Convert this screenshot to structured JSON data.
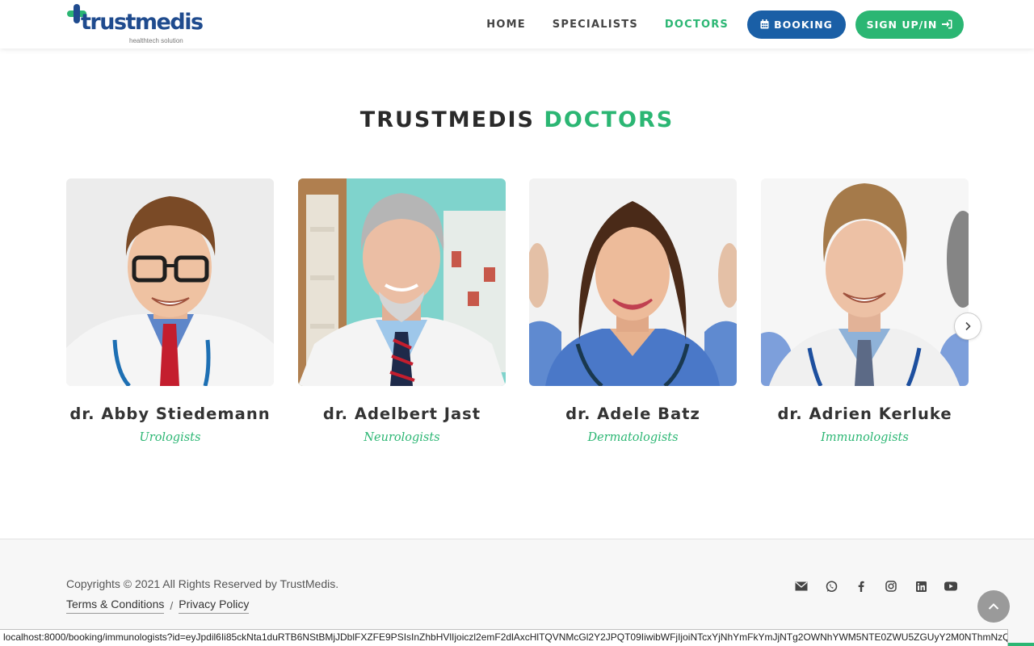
{
  "brand": {
    "name": "trustmedis",
    "tagline": "healthtech solution",
    "primary_color": "#1a5fa6",
    "accent_color": "#2bb673"
  },
  "nav": {
    "links": [
      {
        "label": "HOME",
        "active": false
      },
      {
        "label": "SPECIALISTS",
        "active": false
      },
      {
        "label": "DOCTORS",
        "active": true
      }
    ],
    "booking_label": "BOOKING",
    "booking_icon": "calendar-icon",
    "signup_label": "SIGN UP/IN",
    "signup_icon": "sign-in-icon"
  },
  "section": {
    "title_main": "TRUSTMEDIS",
    "title_accent": "DOCTORS"
  },
  "doctors": [
    {
      "name": "dr. Abby Stiedemann",
      "specialty": "Urologists"
    },
    {
      "name": "dr. Adelbert Jast",
      "specialty": "Neurologists"
    },
    {
      "name": "dr. Adele Batz",
      "specialty": "Dermatologists"
    },
    {
      "name": "dr. Adrien Kerluke",
      "specialty": "Immunologists"
    }
  ],
  "carousel": {
    "next_icon": "chevron-right-icon"
  },
  "footer": {
    "copyright": "Copyrights © 2021 All Rights Reserved by TrustMedis.",
    "terms_label": "Terms & Conditions",
    "separator": "/",
    "privacy_label": "Privacy Policy",
    "social_icons": [
      "envelope-icon",
      "whatsapp-icon",
      "facebook-icon",
      "instagram-icon",
      "linkedin-icon",
      "youtube-icon"
    ],
    "back_to_top_icon": "chevron-up-icon"
  },
  "status_bar": {
    "url": "localhost:8000/booking/immunologists?id=eyJpdil6Ii85ckNta1duRTB6NStBMjJDblFXZFE9PSIsInZhbHVlIjoiczl2emF2dlAxcHlTQVNMcGl2Y2JPQT09IiwibWFjIjoiNTcxYjNhYmFkYmJjNTg2OWNhYWM5NTE0ZWU5ZGUyY2M0NThmNzQyYjJ..."
  }
}
